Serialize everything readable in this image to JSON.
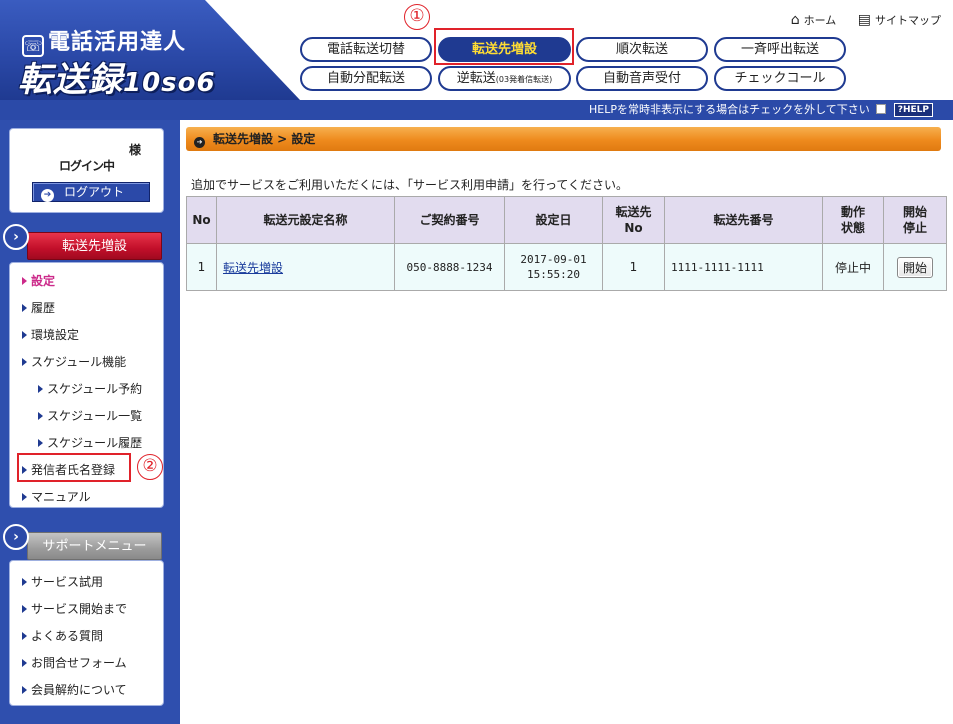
{
  "header": {
    "logo_line1": "電話活用達人",
    "logo_line2_main": "転送録",
    "logo_line2_sub": "10so6",
    "home_label": "ホーム",
    "sitemap_label": "サイトマップ",
    "nav": [
      {
        "label": "電話転送切替"
      },
      {
        "label": "転送先増設",
        "active": true
      },
      {
        "label": "順次転送"
      },
      {
        "label": "一斉呼出転送"
      },
      {
        "label": "自動分配転送"
      },
      {
        "label": "逆転送",
        "small": "(03発着信転送)"
      },
      {
        "label": "自動音声受付"
      },
      {
        "label": "チェックコール"
      }
    ],
    "annotation1": "①"
  },
  "help_bar": {
    "text": "HELPを常時非表示にする場合はチェックを外して下さい",
    "button": "?HELP"
  },
  "sidebar": {
    "user_suffix": "様",
    "login_status": "ログイン中",
    "logout_label": "ログアウト",
    "section_forward": "転送先増設",
    "menu": [
      {
        "label": "設定",
        "current": true
      },
      {
        "label": "履歴"
      },
      {
        "label": "環境設定"
      },
      {
        "label": "スケジュール機能"
      },
      {
        "label": "スケジュール予約",
        "indent": true
      },
      {
        "label": "スケジュール一覧",
        "indent": true
      },
      {
        "label": "スケジュール履歴",
        "indent": true
      },
      {
        "label": "発信者氏名登録"
      },
      {
        "label": "マニュアル"
      }
    ],
    "annotation2": "②",
    "section_support": "サポートメニュー",
    "support_menu": [
      {
        "label": "サービス試用"
      },
      {
        "label": "サービス開始まで"
      },
      {
        "label": "よくある質問"
      },
      {
        "label": "お問合せフォーム"
      },
      {
        "label": "会員解約について"
      }
    ]
  },
  "main": {
    "breadcrumb": "転送先増設 > 設定",
    "notice": "追加でサービスをご利用いただくには、「サービス利用申請」を行ってください。",
    "table": {
      "headers": [
        "No",
        "転送元設定名称",
        "ご契約番号",
        "設定日",
        "転送先\nNo",
        "転送先番号",
        "動作\n状態",
        "開始\n停止"
      ],
      "rows": [
        {
          "no": "1",
          "name": "転送先増設",
          "contract": "050-8888-1234",
          "date": "2017-09-01",
          "time": "15:55:20",
          "dest_no": "1",
          "dest_number": "1111-1111-1111",
          "status": "停止中",
          "action": "開始"
        }
      ]
    }
  },
  "colors": {
    "brand_blue": "#2b49a8",
    "active_nav_text": "#ffdd33",
    "annotation_red": "#e0222a",
    "breadcrumb_orange": "#ee8a1d",
    "current_menu": "#cc2a8a"
  }
}
